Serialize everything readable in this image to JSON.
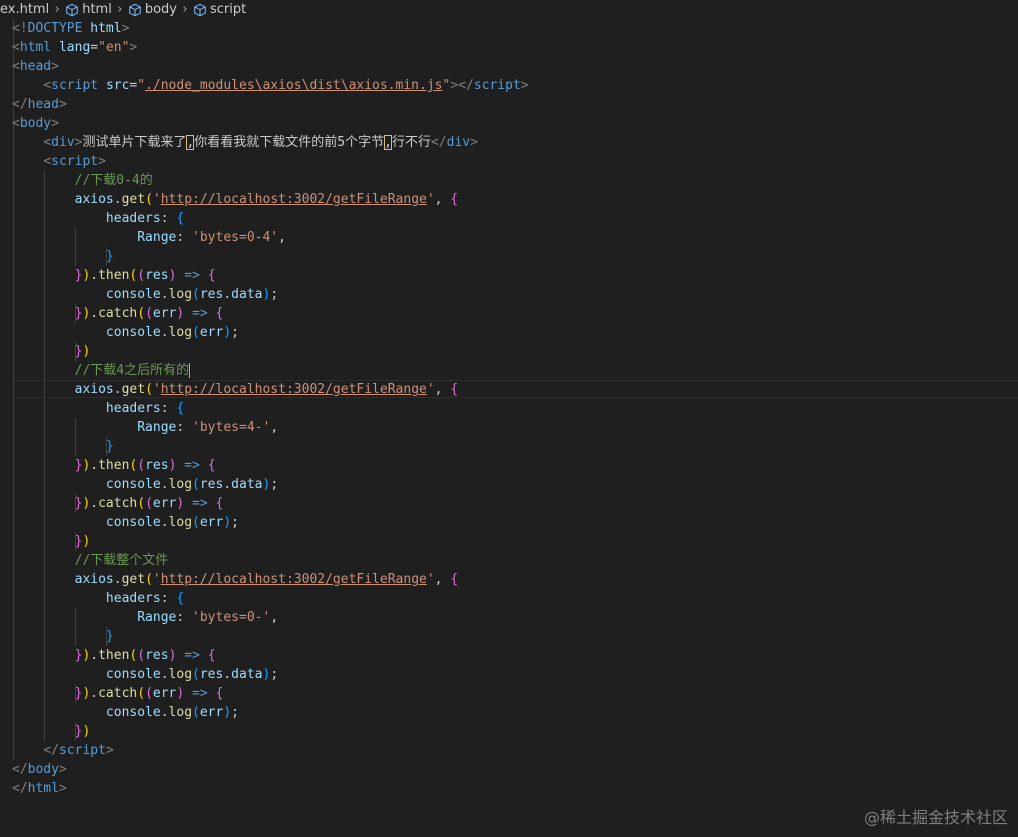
{
  "breadcrumb": {
    "items": [
      {
        "label": "ex.html",
        "icon": "none"
      },
      {
        "label": "html",
        "icon": "cube-icon"
      },
      {
        "label": "body",
        "icon": "cube-icon"
      },
      {
        "label": "script",
        "icon": "cube-icon"
      }
    ]
  },
  "code": {
    "lines": [
      [
        {
          "c": "t-angle",
          "t": "<!"
        },
        {
          "c": "t-doctype-kw",
          "t": "DOCTYPE"
        },
        {
          "c": "t-txt",
          "t": " "
        },
        {
          "c": "t-doctype-name",
          "t": "html"
        },
        {
          "c": "t-angle",
          "t": ">"
        }
      ],
      [
        {
          "c": "t-angle",
          "t": "<"
        },
        {
          "c": "t-tag",
          "t": "html"
        },
        {
          "c": "t-txt",
          "t": " "
        },
        {
          "c": "t-attr",
          "t": "lang"
        },
        {
          "c": "t-txt",
          "t": "="
        },
        {
          "c": "t-str",
          "t": "\"en\""
        },
        {
          "c": "t-angle",
          "t": ">"
        }
      ],
      [
        {
          "c": "t-angle",
          "t": "<"
        },
        {
          "c": "t-tag",
          "t": "head"
        },
        {
          "c": "t-angle",
          "t": ">"
        }
      ],
      [
        {
          "c": "t-txt",
          "t": "    "
        },
        {
          "c": "t-angle",
          "t": "<"
        },
        {
          "c": "t-tag",
          "t": "script"
        },
        {
          "c": "t-txt",
          "t": " "
        },
        {
          "c": "t-attr",
          "t": "src"
        },
        {
          "c": "t-txt",
          "t": "="
        },
        {
          "c": "t-str",
          "t": "\""
        },
        {
          "c": "t-url",
          "t": "./node_modules\\axios\\dist\\axios.min.js"
        },
        {
          "c": "t-str",
          "t": "\""
        },
        {
          "c": "t-angle",
          "t": "></"
        },
        {
          "c": "t-tag",
          "t": "script"
        },
        {
          "c": "t-angle",
          "t": ">"
        }
      ],
      [
        {
          "c": "t-angle",
          "t": "</"
        },
        {
          "c": "t-tag",
          "t": "head"
        },
        {
          "c": "t-angle",
          "t": ">"
        }
      ],
      [
        {
          "c": "t-angle",
          "t": "<"
        },
        {
          "c": "t-tag",
          "t": "body"
        },
        {
          "c": "t-angle",
          "t": ">"
        }
      ],
      [
        {
          "c": "t-txt",
          "t": "    "
        },
        {
          "c": "t-angle",
          "t": "<"
        },
        {
          "c": "t-tag",
          "t": "div"
        },
        {
          "c": "t-angle",
          "t": ">"
        },
        {
          "c": "t-txt",
          "t": "测试单片下载来了"
        },
        {
          "c": "t-txt hl-box",
          "t": ","
        },
        {
          "c": "t-txt",
          "t": "你看看我就下载文件的前5个字节"
        },
        {
          "c": "t-txt hl-box",
          "t": ","
        },
        {
          "c": "t-txt",
          "t": "行不行"
        },
        {
          "c": "t-angle",
          "t": "</"
        },
        {
          "c": "t-tag",
          "t": "div"
        },
        {
          "c": "t-angle",
          "t": ">"
        }
      ],
      [
        {
          "c": "t-txt",
          "t": "    "
        },
        {
          "c": "t-angle",
          "t": "<"
        },
        {
          "c": "t-tag",
          "t": "script"
        },
        {
          "c": "t-angle",
          "t": ">"
        }
      ],
      [
        {
          "c": "t-txt",
          "t": "        "
        },
        {
          "c": "t-com",
          "t": "//下载0-4的"
        }
      ],
      [
        {
          "c": "t-txt",
          "t": "        "
        },
        {
          "c": "t-id",
          "t": "axios"
        },
        {
          "c": "t-op",
          "t": "."
        },
        {
          "c": "t-fn",
          "t": "get"
        },
        {
          "c": "t-p1",
          "t": "("
        },
        {
          "c": "t-str",
          "t": "'"
        },
        {
          "c": "t-url",
          "t": "http://localhost:3002/getFileRange"
        },
        {
          "c": "t-str",
          "t": "'"
        },
        {
          "c": "t-op",
          "t": ", "
        },
        {
          "c": "t-p2",
          "t": "{"
        }
      ],
      [
        {
          "c": "t-txt",
          "t": "            "
        },
        {
          "c": "t-id",
          "t": "headers"
        },
        {
          "c": "t-op",
          "t": ": "
        },
        {
          "c": "t-p3",
          "t": "{"
        }
      ],
      [
        {
          "c": "t-txt",
          "t": "                "
        },
        {
          "c": "t-id",
          "t": "Range"
        },
        {
          "c": "t-op",
          "t": ": "
        },
        {
          "c": "t-str",
          "t": "'bytes=0-4'"
        },
        {
          "c": "t-op",
          "t": ","
        }
      ],
      [
        {
          "c": "t-txt",
          "t": "            "
        },
        {
          "c": "t-p3",
          "t": "}"
        }
      ],
      [
        {
          "c": "t-txt",
          "t": "        "
        },
        {
          "c": "t-p2",
          "t": "}"
        },
        {
          "c": "t-p1",
          "t": ")"
        },
        {
          "c": "t-op",
          "t": "."
        },
        {
          "c": "t-fn",
          "t": "then"
        },
        {
          "c": "t-p1",
          "t": "("
        },
        {
          "c": "t-p2",
          "t": "("
        },
        {
          "c": "t-id",
          "t": "res"
        },
        {
          "c": "t-p2",
          "t": ")"
        },
        {
          "c": "t-op",
          "t": " "
        },
        {
          "c": "t-kw",
          "t": "=>"
        },
        {
          "c": "t-op",
          "t": " "
        },
        {
          "c": "t-p2",
          "t": "{"
        }
      ],
      [
        {
          "c": "t-txt",
          "t": "            "
        },
        {
          "c": "t-id",
          "t": "console"
        },
        {
          "c": "t-op",
          "t": "."
        },
        {
          "c": "t-fn",
          "t": "log"
        },
        {
          "c": "t-p3",
          "t": "("
        },
        {
          "c": "t-id",
          "t": "res"
        },
        {
          "c": "t-op",
          "t": "."
        },
        {
          "c": "t-id",
          "t": "data"
        },
        {
          "c": "t-p3",
          "t": ")"
        },
        {
          "c": "t-op",
          "t": ";"
        }
      ],
      [
        {
          "c": "t-txt",
          "t": "        "
        },
        {
          "c": "t-p2",
          "t": "}"
        },
        {
          "c": "t-p1",
          "t": ")"
        },
        {
          "c": "t-op",
          "t": "."
        },
        {
          "c": "t-fn",
          "t": "catch"
        },
        {
          "c": "t-p1",
          "t": "("
        },
        {
          "c": "t-p2",
          "t": "("
        },
        {
          "c": "t-id",
          "t": "err"
        },
        {
          "c": "t-p2",
          "t": ")"
        },
        {
          "c": "t-op",
          "t": " "
        },
        {
          "c": "t-kw",
          "t": "=>"
        },
        {
          "c": "t-op",
          "t": " "
        },
        {
          "c": "t-p2",
          "t": "{"
        }
      ],
      [
        {
          "c": "t-txt",
          "t": "            "
        },
        {
          "c": "t-id",
          "t": "console"
        },
        {
          "c": "t-op",
          "t": "."
        },
        {
          "c": "t-fn",
          "t": "log"
        },
        {
          "c": "t-p3",
          "t": "("
        },
        {
          "c": "t-id",
          "t": "err"
        },
        {
          "c": "t-p3",
          "t": ")"
        },
        {
          "c": "t-op",
          "t": ";"
        }
      ],
      [
        {
          "c": "t-txt",
          "t": "        "
        },
        {
          "c": "t-p2",
          "t": "}"
        },
        {
          "c": "t-p1",
          "t": ")"
        }
      ],
      [
        {
          "c": "t-txt",
          "t": "        "
        },
        {
          "c": "t-com",
          "t": "//下载4之后所有的"
        },
        {
          "c": "cursor",
          "t": ""
        }
      ],
      [
        {
          "c": "t-txt",
          "t": "        "
        },
        {
          "c": "t-id",
          "t": "axios"
        },
        {
          "c": "t-op",
          "t": "."
        },
        {
          "c": "t-fn",
          "t": "get"
        },
        {
          "c": "t-p1",
          "t": "("
        },
        {
          "c": "t-str",
          "t": "'"
        },
        {
          "c": "t-url",
          "t": "http://localhost:3002/getFileRange"
        },
        {
          "c": "t-str",
          "t": "'"
        },
        {
          "c": "t-op",
          "t": ", "
        },
        {
          "c": "t-p2",
          "t": "{"
        }
      ],
      [
        {
          "c": "t-txt",
          "t": "            "
        },
        {
          "c": "t-id",
          "t": "headers"
        },
        {
          "c": "t-op",
          "t": ": "
        },
        {
          "c": "t-p3",
          "t": "{"
        }
      ],
      [
        {
          "c": "t-txt",
          "t": "                "
        },
        {
          "c": "t-id",
          "t": "Range"
        },
        {
          "c": "t-op",
          "t": ": "
        },
        {
          "c": "t-str",
          "t": "'bytes=4-'"
        },
        {
          "c": "t-op",
          "t": ","
        }
      ],
      [
        {
          "c": "t-txt",
          "t": "            "
        },
        {
          "c": "t-p3",
          "t": "}"
        }
      ],
      [
        {
          "c": "t-txt",
          "t": "        "
        },
        {
          "c": "t-p2",
          "t": "}"
        },
        {
          "c": "t-p1",
          "t": ")"
        },
        {
          "c": "t-op",
          "t": "."
        },
        {
          "c": "t-fn",
          "t": "then"
        },
        {
          "c": "t-p1",
          "t": "("
        },
        {
          "c": "t-p2",
          "t": "("
        },
        {
          "c": "t-id",
          "t": "res"
        },
        {
          "c": "t-p2",
          "t": ")"
        },
        {
          "c": "t-op",
          "t": " "
        },
        {
          "c": "t-kw",
          "t": "=>"
        },
        {
          "c": "t-op",
          "t": " "
        },
        {
          "c": "t-p2",
          "t": "{"
        }
      ],
      [
        {
          "c": "t-txt",
          "t": "            "
        },
        {
          "c": "t-id",
          "t": "console"
        },
        {
          "c": "t-op",
          "t": "."
        },
        {
          "c": "t-fn",
          "t": "log"
        },
        {
          "c": "t-p3",
          "t": "("
        },
        {
          "c": "t-id",
          "t": "res"
        },
        {
          "c": "t-op",
          "t": "."
        },
        {
          "c": "t-id",
          "t": "data"
        },
        {
          "c": "t-p3",
          "t": ")"
        },
        {
          "c": "t-op",
          "t": ";"
        }
      ],
      [
        {
          "c": "t-txt",
          "t": "        "
        },
        {
          "c": "t-p2",
          "t": "}"
        },
        {
          "c": "t-p1",
          "t": ")"
        },
        {
          "c": "t-op",
          "t": "."
        },
        {
          "c": "t-fn",
          "t": "catch"
        },
        {
          "c": "t-p1",
          "t": "("
        },
        {
          "c": "t-p2",
          "t": "("
        },
        {
          "c": "t-id",
          "t": "err"
        },
        {
          "c": "t-p2",
          "t": ")"
        },
        {
          "c": "t-op",
          "t": " "
        },
        {
          "c": "t-kw",
          "t": "=>"
        },
        {
          "c": "t-op",
          "t": " "
        },
        {
          "c": "t-p2",
          "t": "{"
        }
      ],
      [
        {
          "c": "t-txt",
          "t": "            "
        },
        {
          "c": "t-id",
          "t": "console"
        },
        {
          "c": "t-op",
          "t": "."
        },
        {
          "c": "t-fn",
          "t": "log"
        },
        {
          "c": "t-p3",
          "t": "("
        },
        {
          "c": "t-id",
          "t": "err"
        },
        {
          "c": "t-p3",
          "t": ")"
        },
        {
          "c": "t-op",
          "t": ";"
        }
      ],
      [
        {
          "c": "t-txt",
          "t": "        "
        },
        {
          "c": "t-p2",
          "t": "}"
        },
        {
          "c": "t-p1",
          "t": ")"
        }
      ],
      [
        {
          "c": "t-txt",
          "t": "        "
        },
        {
          "c": "t-com",
          "t": "//下载整个文件"
        }
      ],
      [
        {
          "c": "t-txt",
          "t": "        "
        },
        {
          "c": "t-id",
          "t": "axios"
        },
        {
          "c": "t-op",
          "t": "."
        },
        {
          "c": "t-fn",
          "t": "get"
        },
        {
          "c": "t-p1",
          "t": "("
        },
        {
          "c": "t-str",
          "t": "'"
        },
        {
          "c": "t-url",
          "t": "http://localhost:3002/getFileRange"
        },
        {
          "c": "t-str",
          "t": "'"
        },
        {
          "c": "t-op",
          "t": ", "
        },
        {
          "c": "t-p2",
          "t": "{"
        }
      ],
      [
        {
          "c": "t-txt",
          "t": "            "
        },
        {
          "c": "t-id",
          "t": "headers"
        },
        {
          "c": "t-op",
          "t": ": "
        },
        {
          "c": "t-p3",
          "t": "{"
        }
      ],
      [
        {
          "c": "t-txt",
          "t": "                "
        },
        {
          "c": "t-id",
          "t": "Range"
        },
        {
          "c": "t-op",
          "t": ": "
        },
        {
          "c": "t-str",
          "t": "'bytes=0-'"
        },
        {
          "c": "t-op",
          "t": ","
        }
      ],
      [
        {
          "c": "t-txt",
          "t": "            "
        },
        {
          "c": "t-p3",
          "t": "}"
        }
      ],
      [
        {
          "c": "t-txt",
          "t": "        "
        },
        {
          "c": "t-p2",
          "t": "}"
        },
        {
          "c": "t-p1",
          "t": ")"
        },
        {
          "c": "t-op",
          "t": "."
        },
        {
          "c": "t-fn",
          "t": "then"
        },
        {
          "c": "t-p1",
          "t": "("
        },
        {
          "c": "t-p2",
          "t": "("
        },
        {
          "c": "t-id",
          "t": "res"
        },
        {
          "c": "t-p2",
          "t": ")"
        },
        {
          "c": "t-op",
          "t": " "
        },
        {
          "c": "t-kw",
          "t": "=>"
        },
        {
          "c": "t-op",
          "t": " "
        },
        {
          "c": "t-p2",
          "t": "{"
        }
      ],
      [
        {
          "c": "t-txt",
          "t": "            "
        },
        {
          "c": "t-id",
          "t": "console"
        },
        {
          "c": "t-op",
          "t": "."
        },
        {
          "c": "t-fn",
          "t": "log"
        },
        {
          "c": "t-p3",
          "t": "("
        },
        {
          "c": "t-id",
          "t": "res"
        },
        {
          "c": "t-op",
          "t": "."
        },
        {
          "c": "t-id",
          "t": "data"
        },
        {
          "c": "t-p3",
          "t": ")"
        },
        {
          "c": "t-op",
          "t": ";"
        }
      ],
      [
        {
          "c": "t-txt",
          "t": "        "
        },
        {
          "c": "t-p2",
          "t": "}"
        },
        {
          "c": "t-p1",
          "t": ")"
        },
        {
          "c": "t-op",
          "t": "."
        },
        {
          "c": "t-fn",
          "t": "catch"
        },
        {
          "c": "t-p1",
          "t": "("
        },
        {
          "c": "t-p2",
          "t": "("
        },
        {
          "c": "t-id",
          "t": "err"
        },
        {
          "c": "t-p2",
          "t": ")"
        },
        {
          "c": "t-op",
          "t": " "
        },
        {
          "c": "t-kw",
          "t": "=>"
        },
        {
          "c": "t-op",
          "t": " "
        },
        {
          "c": "t-p2",
          "t": "{"
        }
      ],
      [
        {
          "c": "t-txt",
          "t": "            "
        },
        {
          "c": "t-id",
          "t": "console"
        },
        {
          "c": "t-op",
          "t": "."
        },
        {
          "c": "t-fn",
          "t": "log"
        },
        {
          "c": "t-p3",
          "t": "("
        },
        {
          "c": "t-id",
          "t": "err"
        },
        {
          "c": "t-p3",
          "t": ")"
        },
        {
          "c": "t-op",
          "t": ";"
        }
      ],
      [
        {
          "c": "t-txt",
          "t": "        "
        },
        {
          "c": "t-p2",
          "t": "}"
        },
        {
          "c": "t-p1",
          "t": ")"
        }
      ],
      [
        {
          "c": "t-txt",
          "t": "    "
        },
        {
          "c": "t-angle",
          "t": "</"
        },
        {
          "c": "t-tag",
          "t": "script"
        },
        {
          "c": "t-angle",
          "t": ">"
        }
      ],
      [
        {
          "c": "t-angle",
          "t": "</"
        },
        {
          "c": "t-tag",
          "t": "body"
        },
        {
          "c": "t-angle",
          "t": ">"
        }
      ],
      [
        {
          "c": "t-angle",
          "t": "</"
        },
        {
          "c": "t-tag",
          "t": "html"
        },
        {
          "c": "t-angle",
          "t": ">"
        }
      ]
    ]
  },
  "watermark": "@稀土掘金技术社区",
  "colors": {
    "background": "#1f1f1f",
    "tag": "#569cd6",
    "attribute": "#9cdcfe",
    "string": "#ce9178",
    "comment": "#6a9955",
    "function": "#dcdcaa",
    "bracket_level_1": "#ffd700",
    "bracket_level_2": "#da70d6",
    "bracket_level_3": "#179fff"
  }
}
